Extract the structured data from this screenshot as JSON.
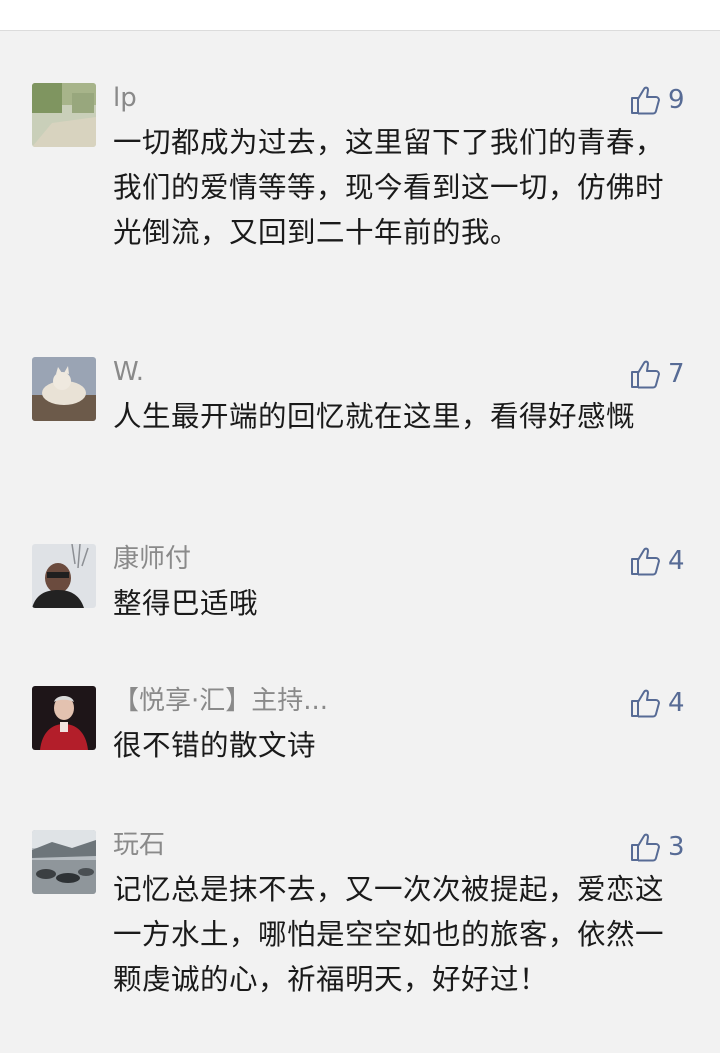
{
  "comments": [
    {
      "name": "lp",
      "likes": "9",
      "text": "一切都成为过去，这里留下了我们的青春，我们的爱情等等，现今看到这一切，仿佛时光倒流，又回到二十年前的我。",
      "avatar_icon": "landscape-photo"
    },
    {
      "name": "W.",
      "likes": "7",
      "text": "人生最开端的回忆就在这里，看得好感慨",
      "avatar_icon": "cat-photo"
    },
    {
      "name": "康师付",
      "likes": "4",
      "text": "整得巴适哦",
      "avatar_icon": "portrait-photo"
    },
    {
      "name": "【悦享·汇】主持...",
      "likes": "4",
      "text": "很不错的散文诗",
      "avatar_icon": "portrait-photo"
    },
    {
      "name": "玩石",
      "likes": "3",
      "text": "记忆总是抹不去，又一次次被提起，爱恋这一方水土，哪怕是空空如也的旅客，依然一颗虔诚的心，祈福明天，好好过！",
      "avatar_icon": "rocks-photo"
    }
  ],
  "colors": {
    "background": "#f2f2f2",
    "name_gray": "#8a8a8a",
    "like_blue": "#576b95",
    "text": "#1a1a1a"
  }
}
